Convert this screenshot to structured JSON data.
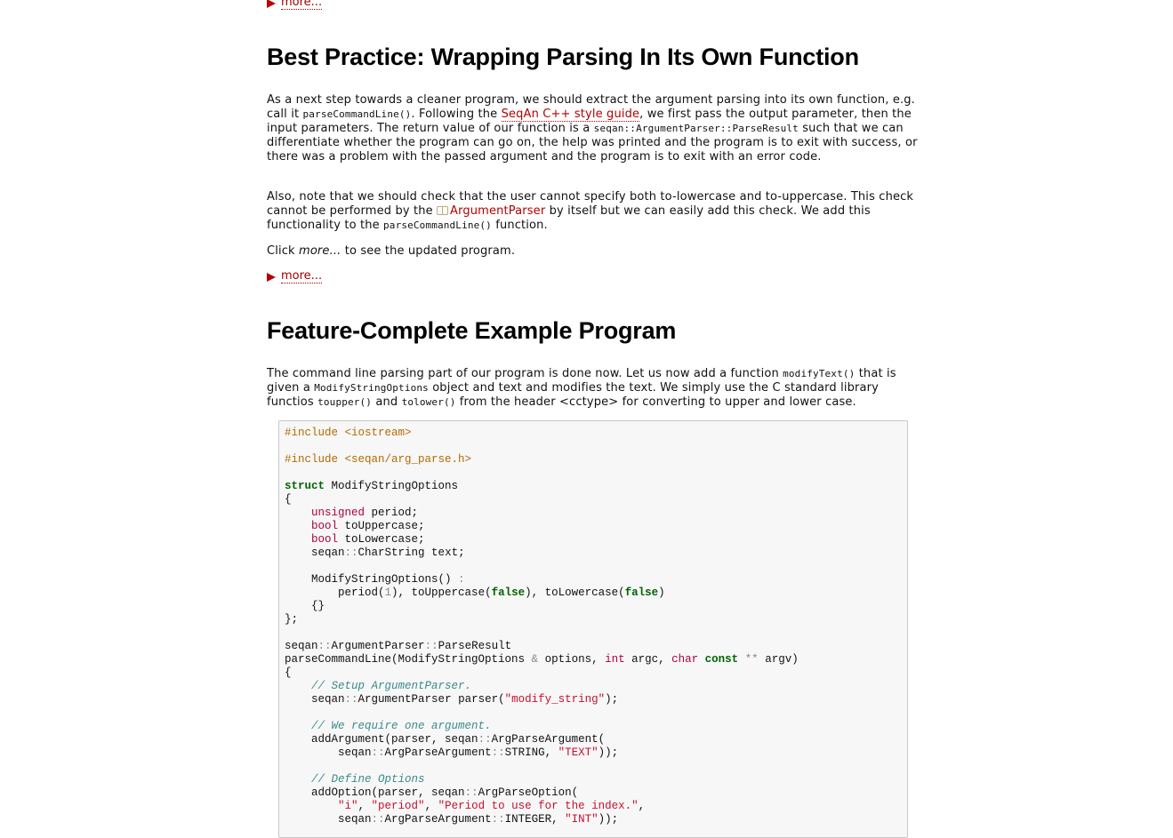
{
  "more_label": "more...",
  "section1": {
    "title": "Best Practice: Wrapping Parsing In Its Own Function",
    "p1_a": "As a next step towards a cleaner program, we should extract the argument parsing into its own function, e.g. call it ",
    "p1_code1": "parseCommandLine()",
    "p1_b": ". Following the ",
    "p1_link": "SeqAn C++ style guide",
    "p1_c": ", we first pass the output parameter, then the input parameters. The return value of our function is a ",
    "p1_code2": "seqan::ArgumentParser::ParseResult",
    "p1_d": " such that we can differentiate whether the program can go on, the help was printed and the program is to exit with success, or there was a problem with the passed argument and the program is to exit with an error code.",
    "p2_a": "Also, note that we should check that the user cannot specify both to-lowercase and to-uppercase. This check cannot be performed by the ",
    "p2_link": "ArgumentParser",
    "p2_b": " by itself but we can easily add this check. We add this functionality to the ",
    "p2_code": "parseCommandLine()",
    "p2_c": " function.",
    "p3_a": "Click ",
    "p3_em": "more...",
    "p3_b": " to see the updated program."
  },
  "section2": {
    "title": "Feature-Complete Example Program",
    "p1_a": "The command line parsing part of our program is done now. Let us now add a function ",
    "p1_code1": "modifyText()",
    "p1_b": " that is given a ",
    "p1_code2": "ModifyStringOptions",
    "p1_c": " object and text and modifies the text. We simply use the C standard library functios ",
    "p1_code3": "toupper()",
    "p1_d": " and ",
    "p1_code4": "tolower()",
    "p1_e": " from the header <cctype> for converting to upper and lower case."
  },
  "code": {
    "include1": "#include <iostream>",
    "include2": "#include <seqan/arg_parse.h>",
    "struct_kw": "struct",
    "struct_name": " ModifyStringOptions",
    "lbrace": "{",
    "t_unsigned": "unsigned",
    "f_period": " period;",
    "t_bool": "bool",
    "f_upper": " toUppercase;",
    "f_lower": " toLowercase;",
    "f_text_ns": "seqan",
    "f_text_rest": "CharString text;",
    "ctor": "ModifyStringOptions() ",
    "colon": ":",
    "init_a": "period(",
    "init_1": "1",
    "init_b": "), toUppercase(",
    "false_kw": "false",
    "init_c": "), toLowercase(",
    "init_d": ")",
    "empty_body": "{}",
    "rbrace": "};",
    "ret_ns": "seqan",
    "ret_cls": "ArgumentParser",
    "ret_type": "ParseResult",
    "fn_a": "parseCommandLine(ModifyStringOptions ",
    "amp": "&",
    "fn_b": " options, ",
    "t_int": "int",
    "fn_c": " argc, ",
    "t_char": "char",
    "const_kw": "const",
    "stars": "**",
    "fn_d": " argv)",
    "cm1": "// Setup ArgumentParser.",
    "parser_a": "ArgumentParser parser(",
    "s_modify": "\"modify_string\"",
    "parser_b": ");",
    "cm2": "// We require one argument.",
    "addarg_a": "addArgument(parser, ",
    "addarg_b": "ArgParseArgument(",
    "apa": "ArgParseArgument",
    "string_c": "STRING, ",
    "s_text": "\"TEXT\"",
    "close2": "));",
    "cm3": "// Define Options",
    "addopt_a": "addOption(parser, ",
    "addopt_b": "ArgParseOption(",
    "s_i": "\"i\"",
    "comma": ", ",
    "s_period": "\"period\"",
    "s_period_desc": "\"Period to use for the index.\"",
    "integer_c": "INTEGER, ",
    "s_int": "\"INT\""
  }
}
